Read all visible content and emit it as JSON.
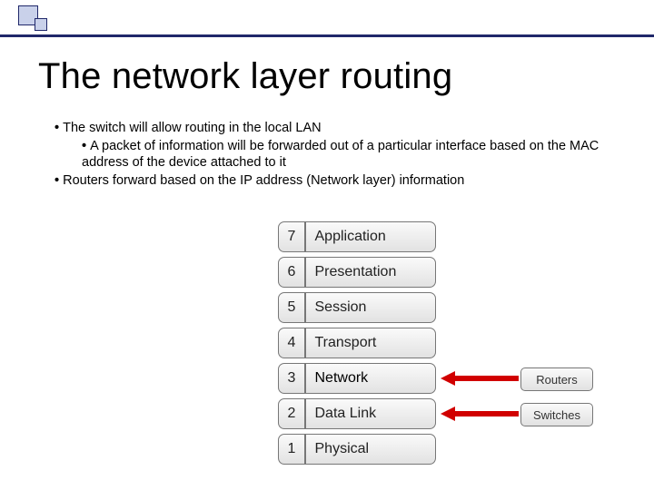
{
  "title": "The network layer routing",
  "bullets": {
    "b1": "The switch will allow routing in the local LAN",
    "b2": "A packet of information will be forwarded out of a particular interface based on the MAC address of the device attached to it",
    "b3": "Routers forward based on the IP address (Network layer) information"
  },
  "osi_layers": [
    {
      "num": "7",
      "name": "Application"
    },
    {
      "num": "6",
      "name": "Presentation"
    },
    {
      "num": "5",
      "name": "Session"
    },
    {
      "num": "4",
      "name": "Transport"
    },
    {
      "num": "3",
      "name": "Network"
    },
    {
      "num": "2",
      "name": "Data Link"
    },
    {
      "num": "1",
      "name": "Physical"
    }
  ],
  "labels": {
    "routers": "Routers",
    "switches": "Switches"
  }
}
